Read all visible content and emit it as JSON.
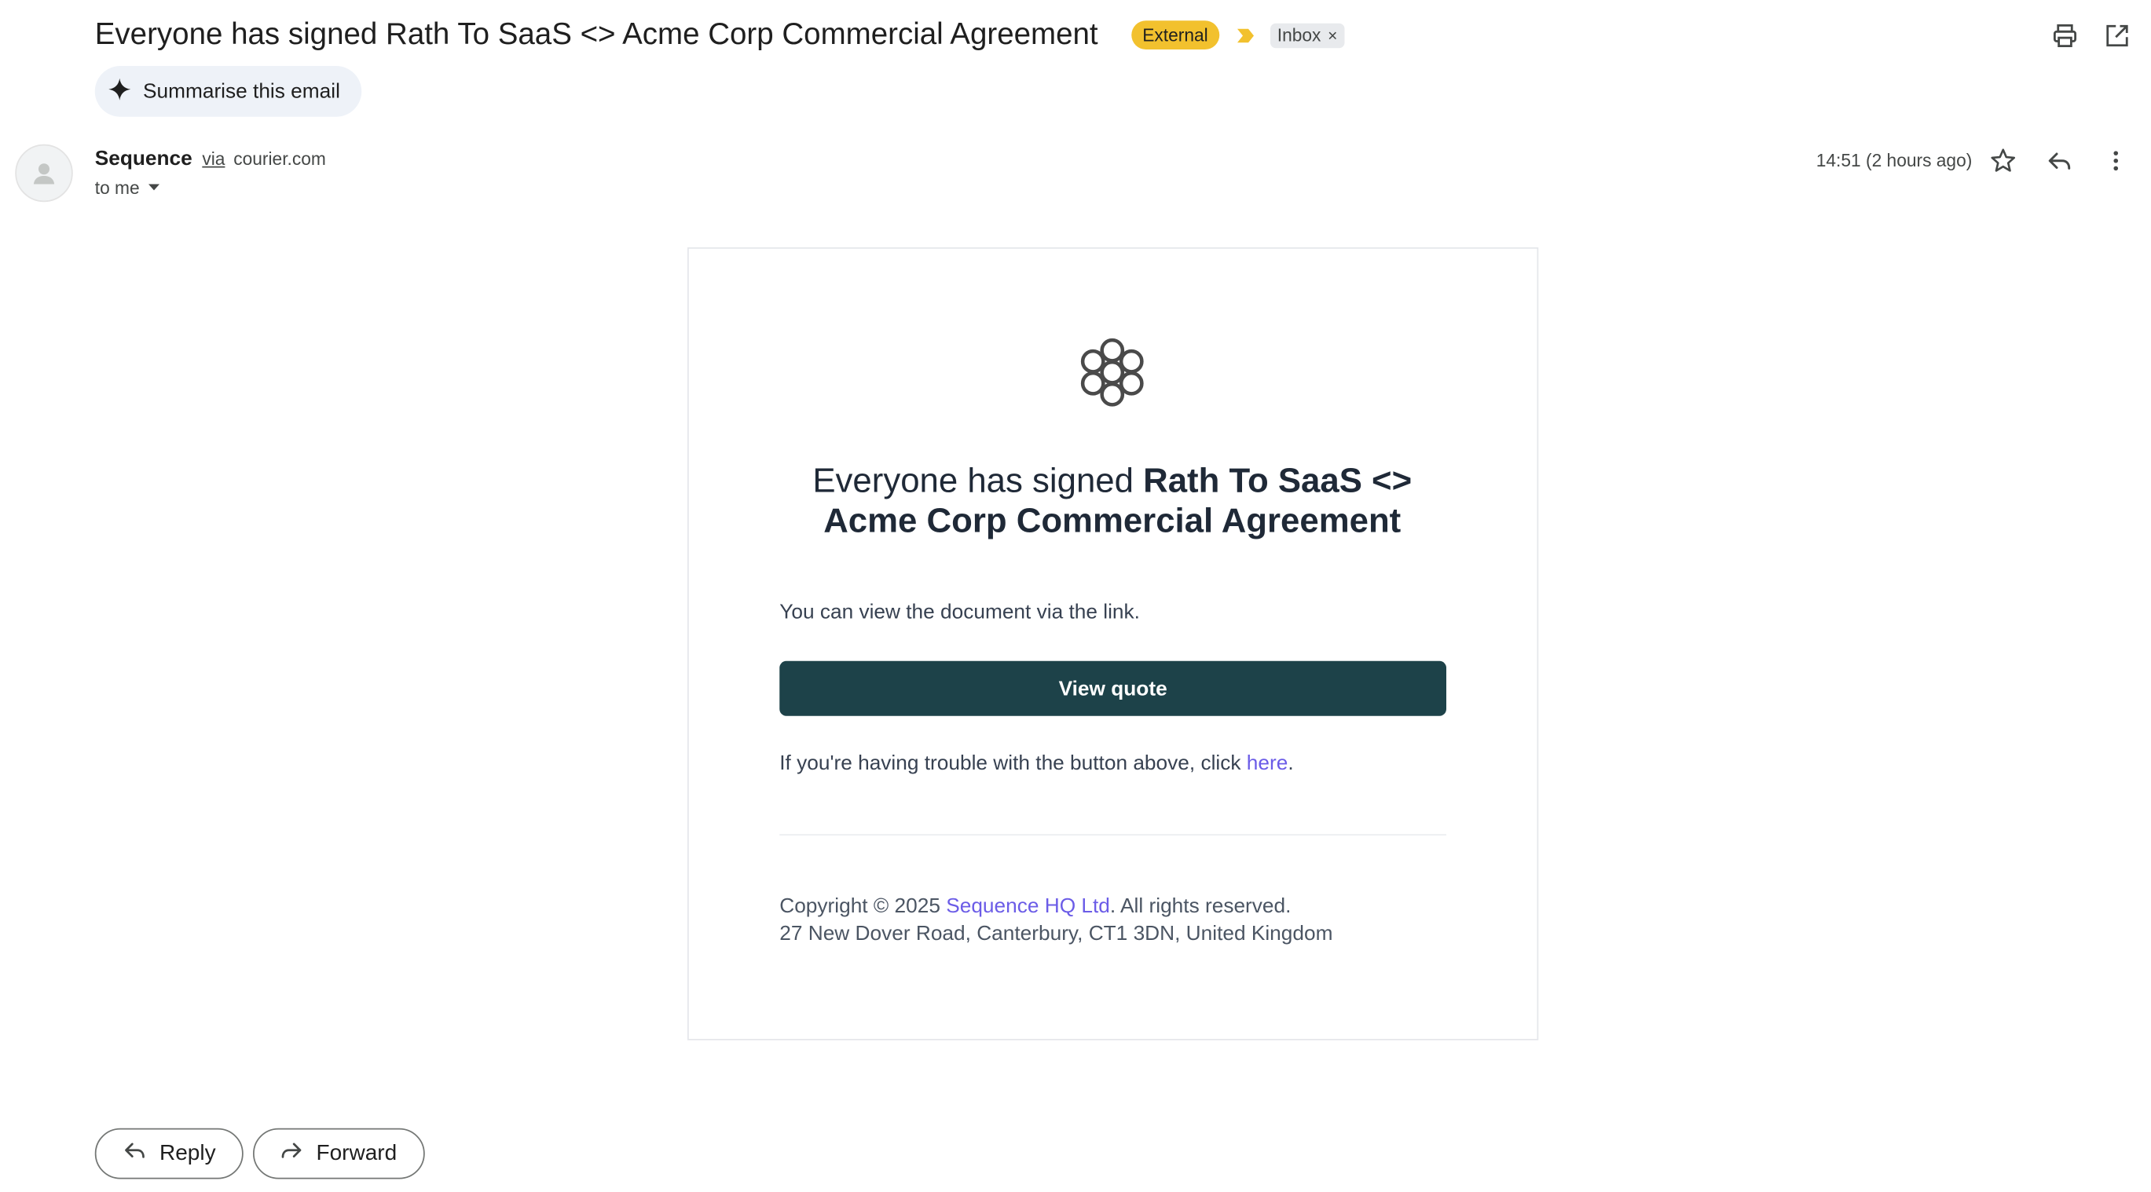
{
  "header": {
    "subject": "Everyone has signed Rath To SaaS <> Acme Corp Commercial Agreement",
    "external_label": "External",
    "inbox_label": "Inbox",
    "inbox_remove": "×",
    "icons": [
      "printer-icon",
      "open-in-new-window-icon"
    ]
  },
  "summarise": {
    "label": "Summarise this email",
    "icon": "sparkle-icon"
  },
  "sender": {
    "name": "Sequence",
    "via": "via",
    "domain": "courier.com",
    "to": "to me",
    "timestamp": "14:51 (2 hours ago)"
  },
  "email": {
    "headline_prefix": "Everyone has signed ",
    "headline_bold": "Rath To SaaS <> Acme Corp Commercial Agreement",
    "body": "You can view the document via the link.",
    "button_label": "View quote",
    "trouble_prefix": "If you're having trouble with the button above, click ",
    "trouble_link": "here",
    "trouble_suffix": ".",
    "copyright_prefix": "Copyright © 2025 ",
    "copyright_link": "Sequence HQ Ltd",
    "copyright_suffix": ". All rights reserved.",
    "address": "27 New Dover Road, Canterbury, CT1 3DN, United Kingdom"
  },
  "actions": {
    "reply_label": "Reply",
    "forward_label": "Forward"
  },
  "colors": {
    "external_badge": "#f2c12e",
    "button": "#1d4249",
    "link": "#6b5ce7",
    "summarise_bg": "#eef2f8"
  }
}
